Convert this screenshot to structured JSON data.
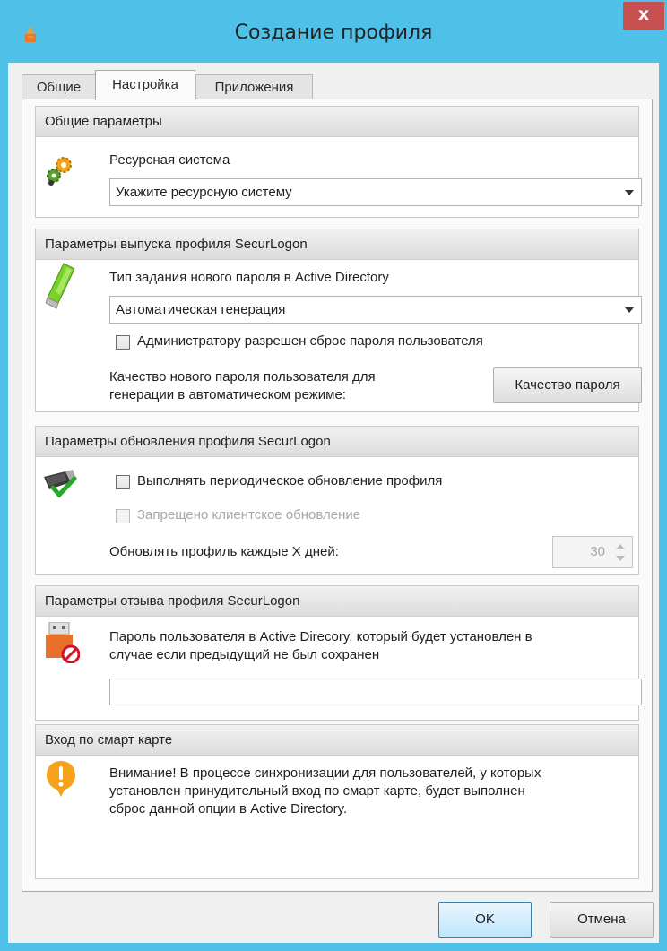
{
  "window": {
    "title": "Создание профиля",
    "close_label": "x"
  },
  "tabs": [
    {
      "label": "Общие",
      "active": false
    },
    {
      "label": "Настройка",
      "active": true
    },
    {
      "label": "Приложения",
      "active": false
    }
  ],
  "general_params": {
    "header": "Общие параметры",
    "resource_system_label": "Ресурсная система",
    "resource_system_value": "Укажите ресурсную систему",
    "icon": "gears-icon"
  },
  "issue_params": {
    "header": "Параметры выпуска профиля SecurLogon",
    "password_type_label": "Тип задания нового пароля в Active Directory",
    "password_type_value": "Автоматическая генерация",
    "admin_reset_label": "Администратору разрешен сброс пароля пользователя",
    "admin_reset_checked": false,
    "quality_text_line1": "Качество нового пароля пользователя для",
    "quality_text_line2": "генерации в автоматическом режиме:",
    "quality_button": "Качество пароля",
    "icon": "usb-token-icon"
  },
  "update_params": {
    "header": "Параметры обновления профиля SecurLogon",
    "periodic_update_label": "Выполнять периодическое обновление профиля",
    "periodic_update_checked": false,
    "client_update_label": "Запрещено клиентское обновление",
    "client_update_checked": false,
    "days_label": "Обновлять профиль каждые X дней:",
    "days_value": "30",
    "icon": "token-check-icon"
  },
  "revoke_params": {
    "header": "Параметры отзыва профиля SecurLogon",
    "text_line1": "Пароль пользователя в Active Direcory, который будет установлен в",
    "text_line2": "случае если предыдущий не был сохранен",
    "password_value": "",
    "icon": "token-revoke-icon"
  },
  "smartcard": {
    "header": "Вход по смарт карте",
    "text_line1": "Внимание! В процессе синхронизации для пользователей, у которых",
    "text_line2": "установлен принудительный вход по смарт карте, будет выполнен",
    "text_line3": "сброс данной опции в Active Directory.",
    "icon": "warning-icon"
  },
  "footer": {
    "ok_label": "OK",
    "cancel_label": "Отмена"
  },
  "colors": {
    "titlebar": "#4fc1e9",
    "close": "#c75050"
  }
}
